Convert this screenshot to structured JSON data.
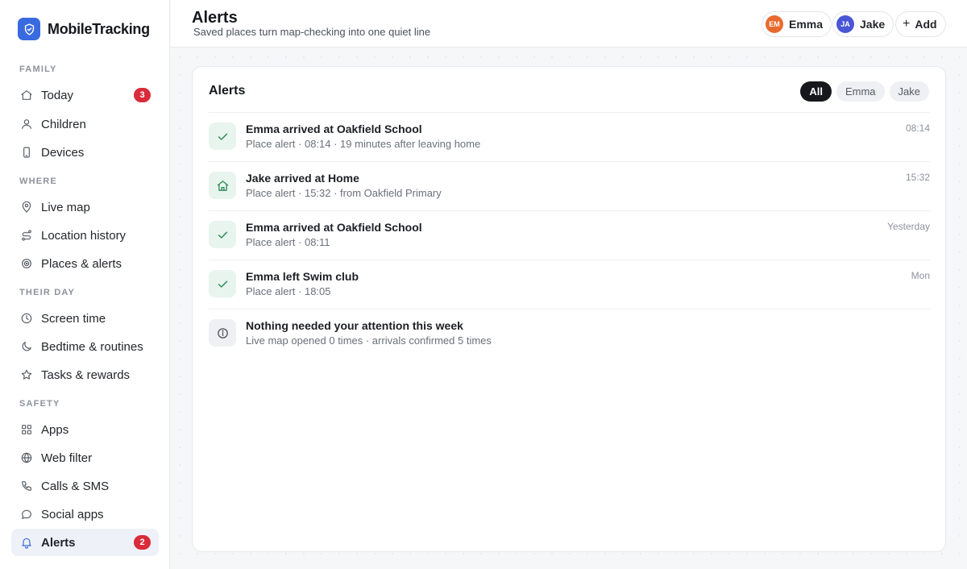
{
  "app": {
    "name": "MobileTracking"
  },
  "sidebar": {
    "sections": [
      {
        "title": "FAMILY",
        "items": [
          {
            "label": "Today",
            "icon": "home-icon",
            "badge": "3"
          },
          {
            "label": "Children",
            "icon": "user-icon"
          },
          {
            "label": "Devices",
            "icon": "phone-icon"
          }
        ]
      },
      {
        "title": "WHERE",
        "items": [
          {
            "label": "Live map",
            "icon": "map-pin-icon"
          },
          {
            "label": "Location history",
            "icon": "route-icon"
          },
          {
            "label": "Places & alerts",
            "icon": "target-icon"
          }
        ]
      },
      {
        "title": "THEIR DAY",
        "items": [
          {
            "label": "Screen time",
            "icon": "clock-icon"
          },
          {
            "label": "Bedtime & routines",
            "icon": "moon-icon"
          },
          {
            "label": "Tasks & rewards",
            "icon": "star-icon"
          }
        ]
      },
      {
        "title": "SAFETY",
        "items": [
          {
            "label": "Apps",
            "icon": "grid-icon"
          },
          {
            "label": "Web filter",
            "icon": "globe-icon"
          },
          {
            "label": "Calls & SMS",
            "icon": "phone-call-icon"
          },
          {
            "label": "Social apps",
            "icon": "chat-icon"
          },
          {
            "label": "Alerts",
            "icon": "bell-icon",
            "badge": "2",
            "active": true
          }
        ]
      }
    ]
  },
  "header": {
    "title": "Alerts",
    "subtitle": "Saved places turn map-checking into one quiet line",
    "profiles": [
      {
        "initials": "EM",
        "name": "Emma",
        "color": "#e8692f"
      },
      {
        "initials": "JA",
        "name": "Jake",
        "color": "#4a56d6"
      }
    ],
    "add_label": "Add"
  },
  "card": {
    "title": "Alerts",
    "filters": [
      {
        "label": "All",
        "active": true
      },
      {
        "label": "Emma"
      },
      {
        "label": "Jake"
      }
    ],
    "alerts": [
      {
        "title": "Emma arrived at Oakfield School",
        "meta": "Place alert · 08:14 · 19 minutes after leaving home",
        "time": "08:14",
        "icon": "check-icon",
        "tone": "green"
      },
      {
        "title": "Jake arrived at Home",
        "meta": "Place alert · 15:32 · from Oakfield Primary",
        "time": "15:32",
        "icon": "home-icon",
        "tone": "green"
      },
      {
        "title": "Emma arrived at Oakfield School",
        "meta": "Place alert · 08:11",
        "time": "Yesterday",
        "icon": "check-icon",
        "tone": "green"
      },
      {
        "title": "Emma left Swim club",
        "meta": "Place alert · 18:05",
        "time": "Mon",
        "icon": "check-icon",
        "tone": "green"
      },
      {
        "title": "Nothing needed your attention this week",
        "meta": "Live map opened 0 times · arrivals confirmed 5 times",
        "time": "",
        "icon": "info-icon",
        "tone": "grey"
      }
    ]
  },
  "colors": {
    "accent": "#3a6ae0",
    "badge": "#d92b3a",
    "success": "#2e8b57",
    "active_filter": "#16181c"
  }
}
